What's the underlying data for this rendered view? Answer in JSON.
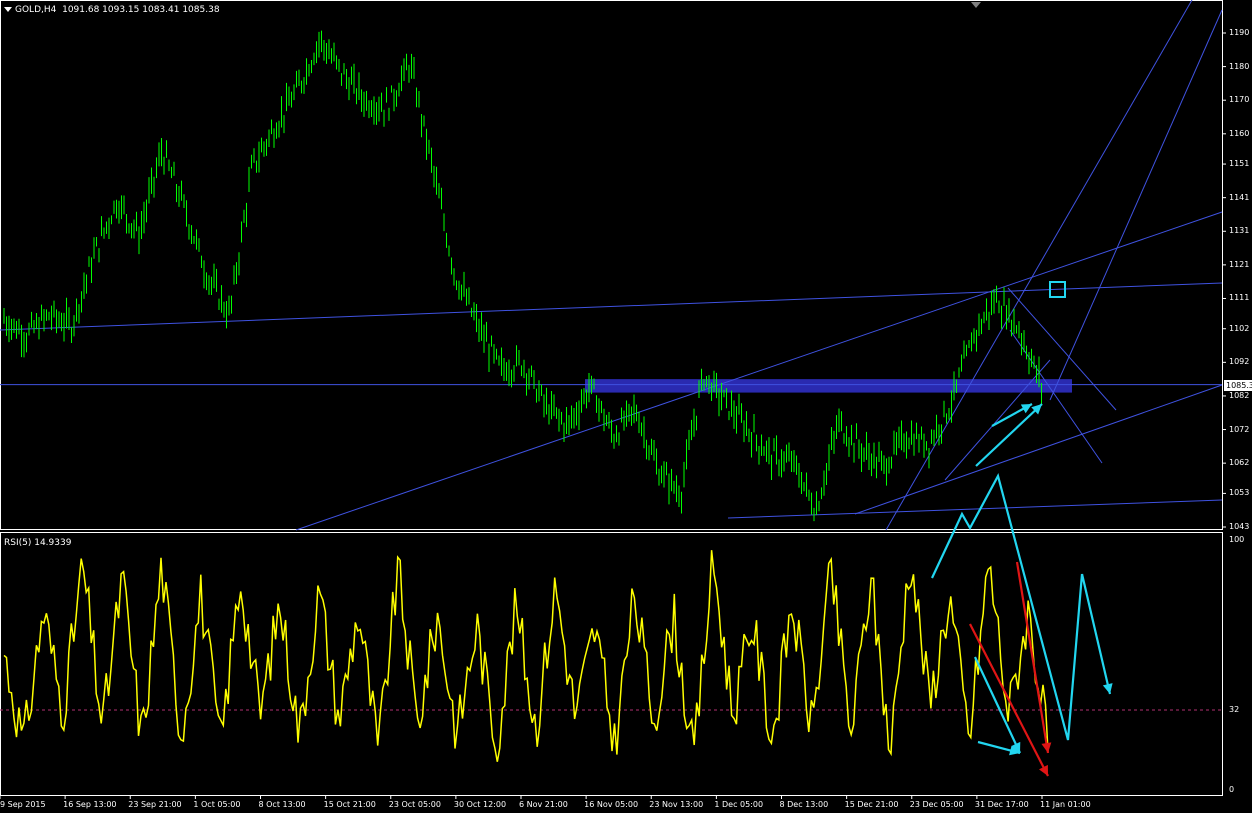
{
  "header": {
    "symbol": "GOLD,H4",
    "ohlc": "1091.68 1093.15 1083.41 1085.38"
  },
  "indicator": {
    "label": "RSI(5) 14.9339"
  },
  "colors": {
    "background": "#000000",
    "candles": "#00ff00",
    "trendlines": "#3f52e0",
    "zone": "#2a2ab0",
    "rsi_line": "#ffff00",
    "rsi_level": "#b03070",
    "annotation_cyan": "#22d6f0",
    "annotation_red": "#e01515",
    "axis_text": "#ffffff"
  },
  "price_axis": {
    "ticks": [
      "1190",
      "1180",
      "1170",
      "1160",
      "1151",
      "1141",
      "1131",
      "1121",
      "1111",
      "1102",
      "1092",
      "1082",
      "1072",
      "1062",
      "1053",
      "1043"
    ],
    "current_price": "1085.38"
  },
  "rsi_axis": {
    "ticks": [
      "100",
      "32",
      "0"
    ]
  },
  "time_axis": {
    "labels": [
      "9 Sep 2015",
      "16 Sep 13:00",
      "23 Sep 21:00",
      "1 Oct 05:00",
      "8 Oct 13:00",
      "15 Oct 21:00",
      "23 Oct 05:00",
      "30 Oct 12:00",
      "6 Nov 21:00",
      "16 Nov 05:00",
      "23 Nov 13:00",
      "1 Dec 05:00",
      "8 Dec 13:00",
      "15 Dec 21:00",
      "23 Dec 05:00",
      "31 Dec 17:00",
      "11 Jan 01:00"
    ]
  },
  "chart_data": [
    {
      "type": "line",
      "title": "GOLD,H4",
      "ylim": [
        1040,
        1195
      ],
      "x_labels": [
        "9 Sep 2015",
        "16 Sep 13:00",
        "23 Sep 21:00",
        "1 Oct 05:00",
        "8 Oct 13:00",
        "15 Oct 21:00",
        "23 Oct 05:00",
        "30 Oct 12:00",
        "6 Nov 21:00",
        "16 Nov 05:00",
        "23 Nov 13:00",
        "1 Dec 05:00",
        "8 Dec 13:00",
        "15 Dec 21:00",
        "23 Dec 05:00",
        "31 Dec 17:00",
        "11 Jan 01:00"
      ],
      "series": [
        {
          "values": [
            1105,
            1100,
            1106,
            1103,
            1124,
            1140,
            1130,
            1155,
            1138,
            1118,
            1106,
            1150,
            1162,
            1173,
            1188,
            1178,
            1170,
            1168,
            1181,
            1150,
            1118,
            1103,
            1090,
            1092,
            1079,
            1073,
            1085,
            1070,
            1078,
            1060,
            1053,
            1088,
            1080,
            1072,
            1064,
            1062,
            1048,
            1074,
            1066,
            1061,
            1070,
            1068,
            1080,
            1100,
            1111,
            1102,
            1085
          ]
        }
      ],
      "level": 1085.38,
      "zone": [
        1083,
        1087
      ]
    },
    {
      "type": "line",
      "title": "RSI(5) 14.9339",
      "ylim": [
        0,
        100
      ],
      "levels": [
        32
      ],
      "series": [
        {
          "values": [
            55,
            18,
            72,
            32,
            90,
            25,
            85,
            20,
            90,
            22,
            78,
            18,
            85,
            30,
            75,
            22,
            80,
            28,
            72,
            15,
            88,
            26,
            70,
            22,
            66,
            18,
            74,
            24,
            82,
            30,
            65,
            18,
            78,
            28,
            70,
            12,
            92,
            30,
            68,
            20,
            75,
            25,
            88,
            22,
            85,
            15,
            95,
            34,
            78,
            20,
            92,
            30,
            72,
            18
          ]
        }
      ]
    }
  ]
}
